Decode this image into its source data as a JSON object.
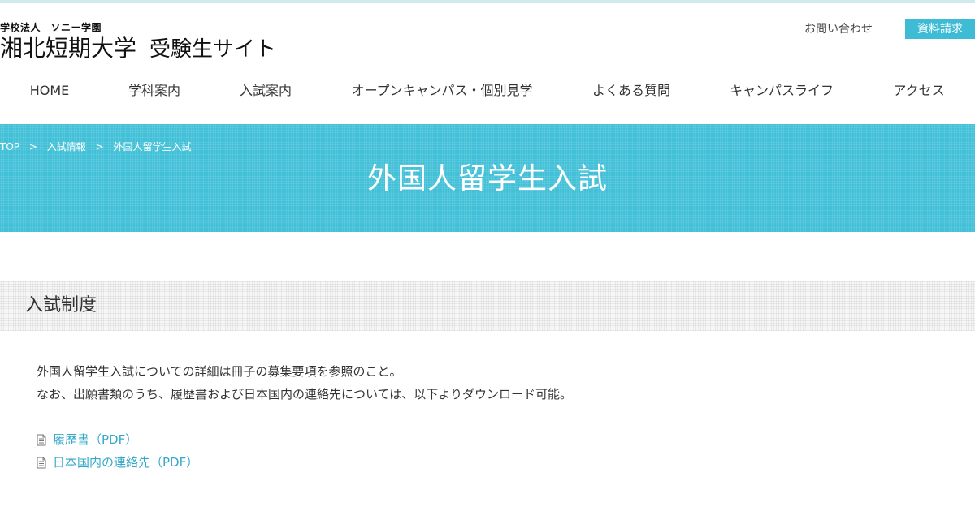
{
  "header": {
    "org": "学校法人　ソニー学園",
    "college": "湘北短期大学",
    "site": "受験生サイト",
    "contact_label": "お問い合わせ",
    "request_label": "資料請求"
  },
  "nav": {
    "items": [
      {
        "label": "HOME"
      },
      {
        "label": "学科案内"
      },
      {
        "label": "入試案内"
      },
      {
        "label": "オープンキャンパス・個別見学"
      },
      {
        "label": "よくある質問"
      },
      {
        "label": "キャンパスライフ"
      },
      {
        "label": "アクセス"
      }
    ]
  },
  "breadcrumb": {
    "items": [
      "TOP",
      "入試情報",
      "外国人留学生入試"
    ],
    "separator": ">"
  },
  "hero": {
    "title": "外国人留学生入試"
  },
  "section": {
    "title": "入試制度",
    "paragraphs": [
      "外国人留学生入試についての詳細は冊子の募集要項を参照のこと。",
      "なお、出願書類のうち、履歴書および日本国内の連絡先については、以下よりダウンロード可能。"
    ],
    "downloads": [
      {
        "label": "履歴書（PDF）",
        "icon": "document-icon"
      },
      {
        "label": "日本国内の連絡先（PDF）",
        "icon": "document-icon"
      }
    ]
  },
  "colors": {
    "accent": "#42c0d8",
    "button": "#3fbcd5",
    "link": "#34a9c7"
  }
}
